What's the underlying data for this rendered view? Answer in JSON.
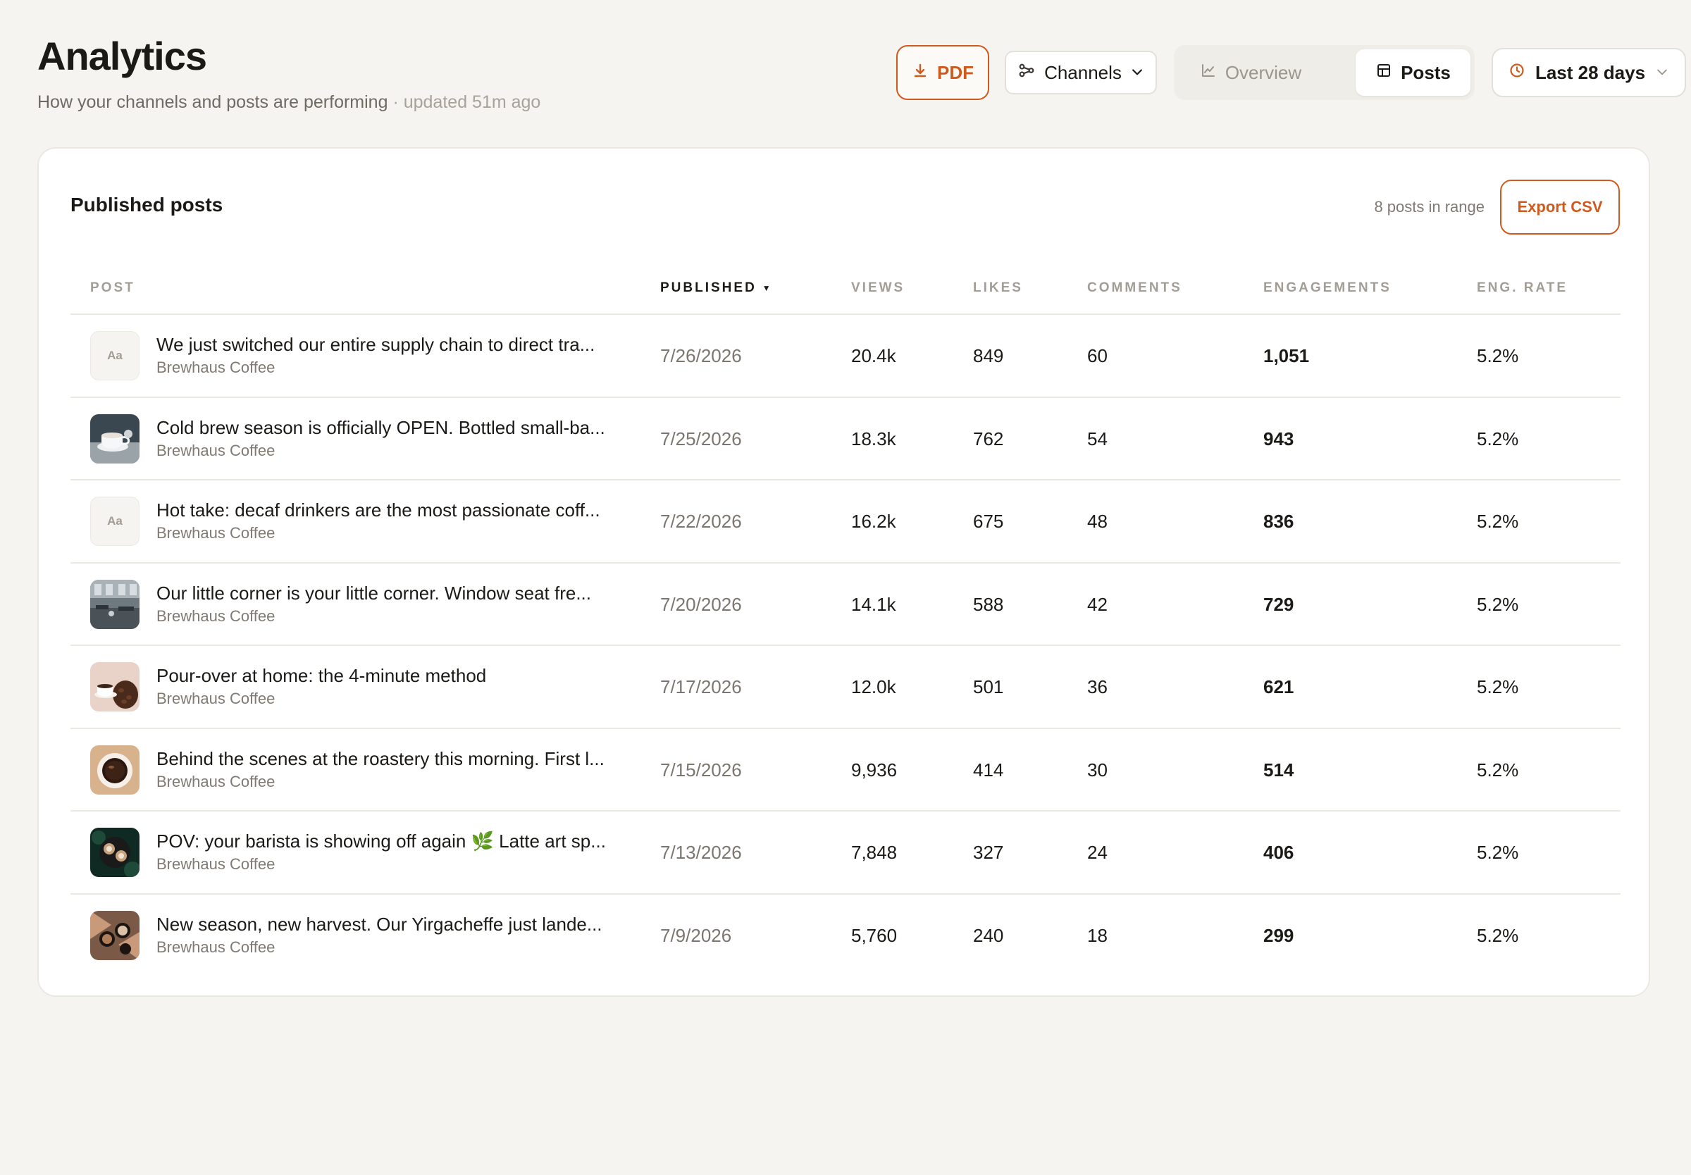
{
  "header": {
    "title": "Analytics",
    "subtitle": "How your channels and posts are performing",
    "updated": "· updated 51m ago"
  },
  "toolbar": {
    "pdf_label": "PDF",
    "channels_label": "Channels",
    "overview_label": "Overview",
    "posts_label": "Posts",
    "range_label": "Last 28 days"
  },
  "card": {
    "title": "Published posts",
    "count_text": "8 posts in range",
    "export_label": "Export CSV"
  },
  "columns": {
    "post": "POST",
    "published": "PUBLISHED",
    "views": "VIEWS",
    "likes": "LIKES",
    "comments": "COMMENTS",
    "engagements": "ENGAGEMENTS",
    "rate": "ENG. RATE"
  },
  "rows": [
    {
      "thumb": "text",
      "thumb_label": "Aa",
      "title": "We just switched our entire supply chain to direct tra...",
      "channel": "Brewhaus Coffee",
      "published": "7/26/2026",
      "views": "20.4k",
      "likes": "849",
      "comments": "60",
      "engagements": "1,051",
      "rate": "5.2%"
    },
    {
      "thumb": "cup",
      "title": "Cold brew season is officially OPEN. Bottled small-ba...",
      "channel": "Brewhaus Coffee",
      "published": "7/25/2026",
      "views": "18.3k",
      "likes": "762",
      "comments": "54",
      "engagements": "943",
      "rate": "5.2%"
    },
    {
      "thumb": "text",
      "thumb_label": "Aa",
      "title": "Hot take: decaf drinkers are the most passionate coff...",
      "channel": "Brewhaus Coffee",
      "published": "7/22/2026",
      "views": "16.2k",
      "likes": "675",
      "comments": "48",
      "engagements": "836",
      "rate": "5.2%"
    },
    {
      "thumb": "cafe",
      "title": "Our little corner is your little corner. Window seat fre...",
      "channel": "Brewhaus Coffee",
      "published": "7/20/2026",
      "views": "14.1k",
      "likes": "588",
      "comments": "42",
      "engagements": "729",
      "rate": "5.2%"
    },
    {
      "thumb": "beans",
      "title": "Pour-over at home: the 4-minute method",
      "channel": "Brewhaus Coffee",
      "published": "7/17/2026",
      "views": "12.0k",
      "likes": "501",
      "comments": "36",
      "engagements": "621",
      "rate": "5.2%"
    },
    {
      "thumb": "topcup",
      "title": "Behind the scenes at the roastery this morning. First l...",
      "channel": "Brewhaus Coffee",
      "published": "7/15/2026",
      "views": "9,936",
      "likes": "414",
      "comments": "30",
      "engagements": "514",
      "rate": "5.2%"
    },
    {
      "thumb": "latte",
      "title": "POV: your barista is showing off again 🌿  Latte art sp...",
      "channel": "Brewhaus Coffee",
      "published": "7/13/2026",
      "views": "7,848",
      "likes": "327",
      "comments": "24",
      "engagements": "406",
      "rate": "5.2%"
    },
    {
      "thumb": "hands",
      "title": "New season, new harvest. Our Yirgacheffe just lande...",
      "channel": "Brewhaus Coffee",
      "published": "7/9/2026",
      "views": "5,760",
      "likes": "240",
      "comments": "18",
      "engagements": "299",
      "rate": "5.2%"
    }
  ],
  "colors": {
    "accent": "#cf5a1e",
    "background": "#f5f4f0",
    "card": "#ffffff",
    "text": "#1c1a17",
    "muted": "#807a72"
  },
  "icons": {
    "pdf": "download-icon",
    "channels": "share-nodes-icon",
    "channels_caret": "chevron-down-icon",
    "overview": "line-chart-icon",
    "posts": "table-icon",
    "range": "clock-icon",
    "range_caret": "chevron-down-icon"
  }
}
